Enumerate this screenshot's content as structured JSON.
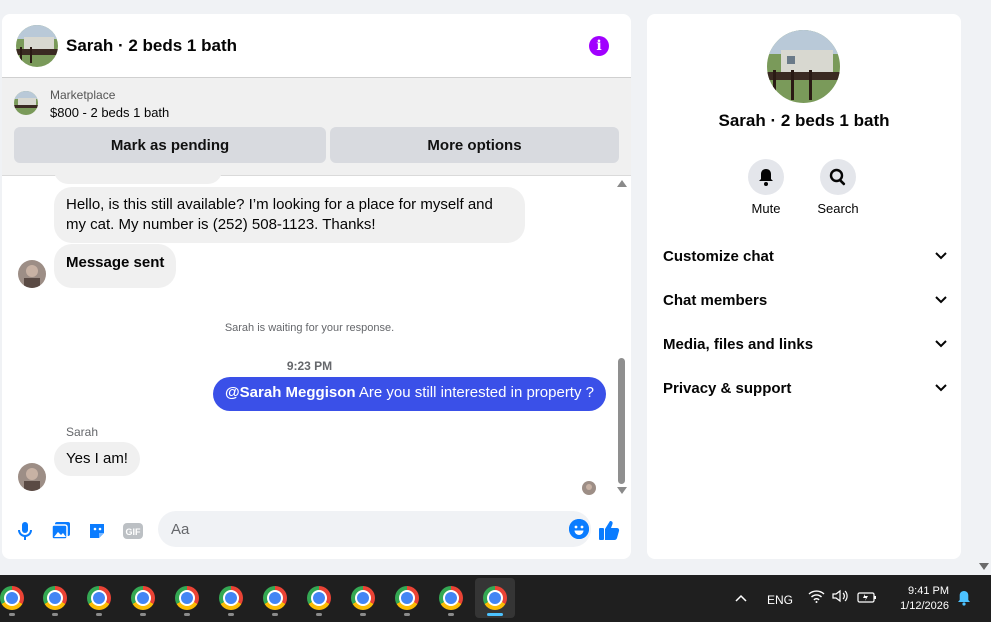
{
  "header": {
    "title": "Sarah · 2 beds 1 bath"
  },
  "marketplace": {
    "label": "Marketplace",
    "price_title": "$800 - 2 beds 1 bath",
    "pending_button": "Mark as pending",
    "more_button": "More options"
  },
  "messages": {
    "incoming_1": "Hello, is this still available? I’m looking for a place for myself and my cat. My number is (252) 508-1123. Thanks!",
    "status": "Message sent",
    "waiting_note": "Sarah is waiting for your response.",
    "time": "9:23 PM",
    "outgoing_mention": "@Sarah Meggison",
    "outgoing_text": " Are you still interested in property ?",
    "sender_name": "Sarah",
    "incoming_2": "Yes I am!"
  },
  "composer": {
    "placeholder": "Aa",
    "gif_label": "GIF"
  },
  "info_panel": {
    "title": "Sarah · 2 beds 1 bath",
    "mute_label": "Mute",
    "search_label": "Search",
    "sections": [
      "Customize chat",
      "Chat members",
      "Media, files and links",
      "Privacy & support"
    ]
  },
  "taskbar": {
    "language": "ENG",
    "time": "9:41 PM",
    "date": "1/12/2026"
  },
  "colors": {
    "accent": "#0a7cff",
    "outgoing_bubble": "#3a50e8",
    "info_icon": "#a100ff"
  }
}
